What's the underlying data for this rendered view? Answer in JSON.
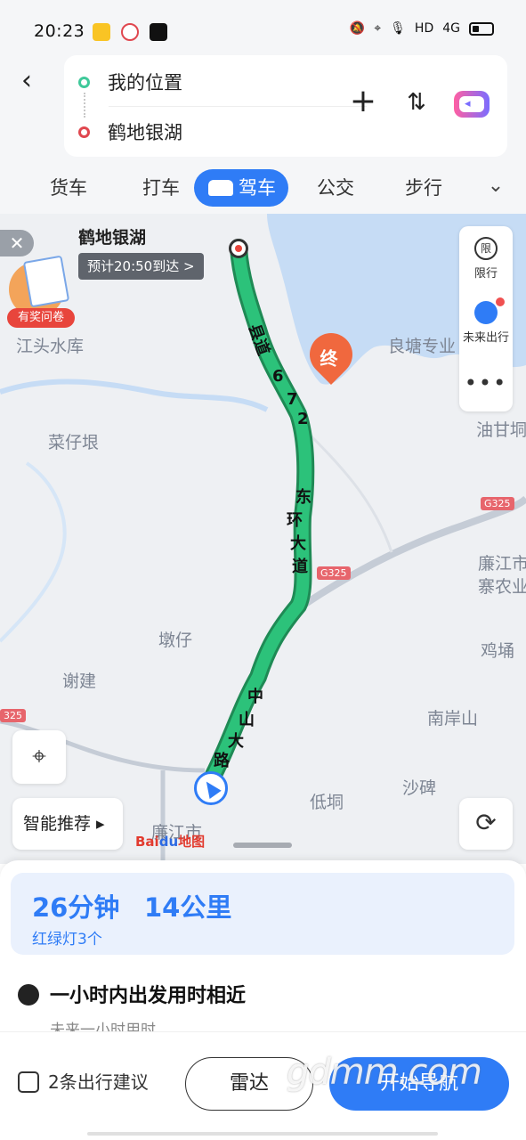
{
  "status_bar": {
    "time": "20:23",
    "network": "HD",
    "signal": "4G"
  },
  "header": {
    "origin": "我的位置",
    "destination": "鹤地银湖",
    "add_label": "+",
    "swap_label": "⇅"
  },
  "modes": [
    {
      "label": "货车"
    },
    {
      "label": "打车"
    },
    {
      "label": "驾车"
    },
    {
      "label": "公交"
    },
    {
      "label": "步行"
    }
  ],
  "map": {
    "destination_title": "鹤地银湖",
    "eta": "预计20:50到达 >",
    "survey_label": "有奖问卷",
    "end_marker": "终",
    "side_panel": {
      "limit": "限行",
      "limit_icon": "限",
      "future": "未来出行"
    },
    "smart_recommend": "智能推荐",
    "places": [
      "江头水库",
      "菜仔垠",
      "良塘专业",
      "油甘垌",
      "廉江市",
      "寨农业",
      "鸡埇",
      "墩仔",
      "谢建",
      "南岸山",
      "低垌",
      "沙碑",
      "廉江市"
    ],
    "roads": [
      "县道",
      "6",
      "7",
      "2",
      "东",
      "环",
      "大",
      "道",
      "中",
      "山",
      "大",
      "路"
    ],
    "badges": [
      "G325",
      "G325",
      "325"
    ],
    "brand": "Bai",
    "brand_paw": "du",
    "brand_suffix": "地图"
  },
  "route": {
    "duration": "26分钟",
    "distance": "14公里",
    "traffic_lights": "红绿灯3个",
    "depart_title": "一小时内出发用时相近",
    "depart_sub": "未来一小时用时"
  },
  "bottom": {
    "suggestions": "2条出行建议",
    "radar": "雷达",
    "start_nav": "开始导航",
    "watermark": "gdmm.com"
  },
  "colors": {
    "accent": "#2f7cf6",
    "route": "#22b573",
    "danger": "#e8453c"
  }
}
